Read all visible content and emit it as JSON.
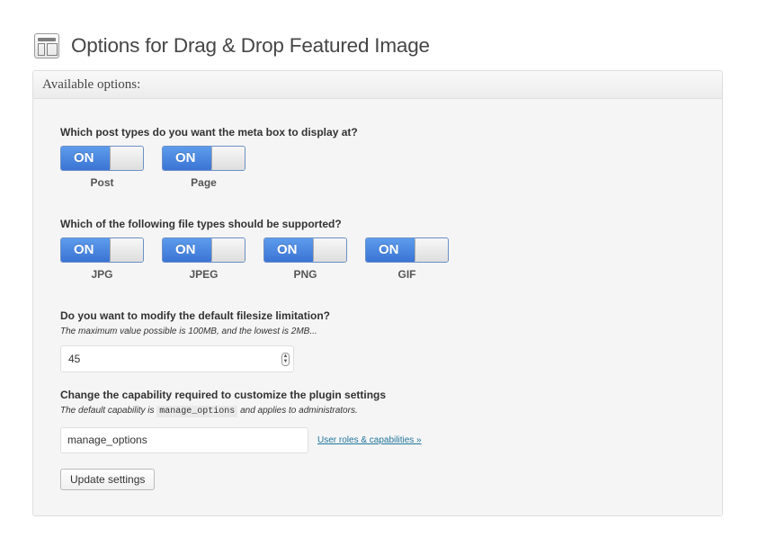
{
  "header": {
    "icon": "options-page-icon",
    "title": "Options for Drag & Drop Featured Image"
  },
  "box": {
    "heading": "Available options:"
  },
  "post_types": {
    "question": "Which post types do you want the meta box to display at?",
    "items": [
      {
        "label": "Post",
        "state": "ON"
      },
      {
        "label": "Page",
        "state": "ON"
      }
    ]
  },
  "file_types": {
    "question": "Which of the following file types should be supported?",
    "items": [
      {
        "label": "JPG",
        "state": "ON"
      },
      {
        "label": "JPEG",
        "state": "ON"
      },
      {
        "label": "PNG",
        "state": "ON"
      },
      {
        "label": "GIF",
        "state": "ON"
      }
    ]
  },
  "filesize": {
    "question": "Do you want to modify the default filesize limitation?",
    "hint": "The maximum value possible is 100MB, and the lowest is 2MB...",
    "value": "45"
  },
  "capability": {
    "question": "Change the capability required to customize the plugin settings",
    "hint_before": "The default capability is",
    "hint_code": "manage_options",
    "hint_after": "and applies to administrators.",
    "value": "manage_options",
    "link": "User roles & capabilities »"
  },
  "submit": {
    "label": "Update settings"
  },
  "colors": {
    "toggle_on": "#3b74d4",
    "link": "#21759b"
  }
}
